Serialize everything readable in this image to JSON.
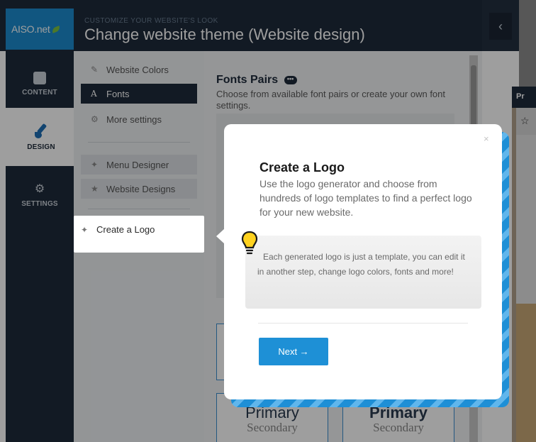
{
  "header": {
    "logo_text": "AISO.net",
    "subtitle": "CUSTOMIZE YOUR WEBSITE'S LOOK",
    "title": "Change website theme (Website design)",
    "collapse_icon": "‹"
  },
  "sidebar": {
    "items": [
      {
        "label": "CONTENT",
        "icon": "plus-square-icon"
      },
      {
        "label": "DESIGN",
        "icon": "paint-brush-icon"
      },
      {
        "label": "SETTINGS",
        "icon": "gears-icon"
      }
    ]
  },
  "menu": {
    "items": [
      {
        "label": "Website Colors",
        "icon": "brush-icon"
      },
      {
        "label": "Fonts",
        "icon": "font-icon"
      },
      {
        "label": "More settings",
        "icon": "gears-icon"
      },
      {
        "label": "Menu Designer",
        "icon": "magic-wand-icon"
      },
      {
        "label": "Website Designs",
        "icon": "star-icon"
      },
      {
        "label": "Create a Logo",
        "icon": "magic-wand-icon"
      }
    ]
  },
  "main": {
    "title": "Fonts Pairs",
    "description": "Choose from available font pairs or create your own font settings.",
    "pairs": [
      {
        "primary": "Primary",
        "secondary": "Secondary"
      },
      {
        "primary": "Primary",
        "secondary": "Secondary"
      }
    ]
  },
  "preview": {
    "label": "Pr",
    "icon_glyph": "☆"
  },
  "popup": {
    "title": "Create a Logo",
    "description": "Use the logo generator and choose from hundreds of logo templates to find a perfect logo for your new website.",
    "tip": "Each generated logo is just a template, you can edit it in another step, change logo colors, fonts and more!",
    "next_label": "Next →",
    "close_glyph": "×"
  },
  "colors": {
    "accent": "#1e90d6",
    "dark": "#1e2a3a",
    "logo_bg": "#1c8ccf"
  }
}
